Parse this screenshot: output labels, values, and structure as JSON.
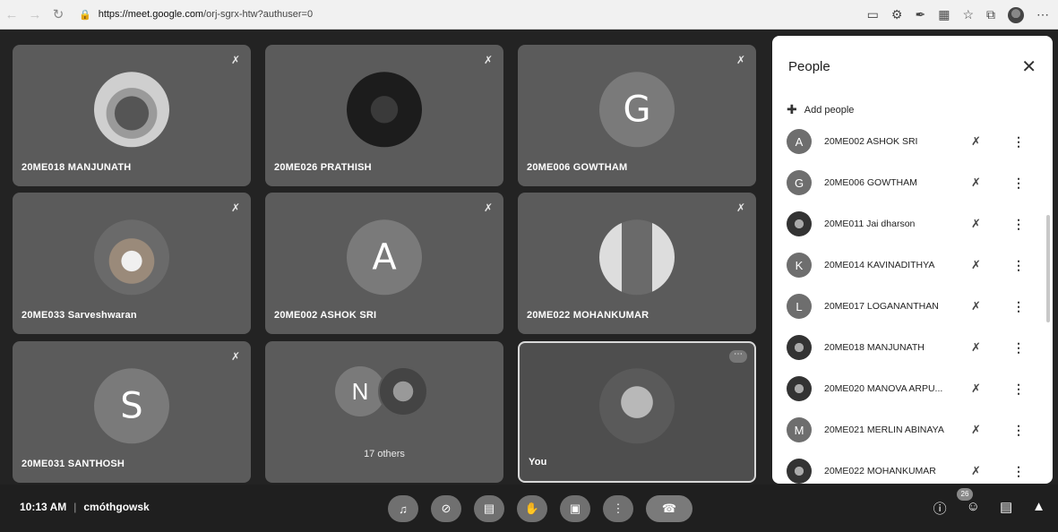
{
  "browser": {
    "url_host": "https://meet.google.com",
    "url_path": "/orj-sgrx-htw?authuser=0",
    "lock_icon": "lock-icon"
  },
  "tiles": [
    {
      "name": "20ME018 MANJUNATH",
      "avatar": "photo"
    },
    {
      "name": "20ME026 PRATHISH",
      "avatar": "photo"
    },
    {
      "name": "20ME006 GOWTHAM",
      "letter": "G"
    },
    {
      "name": "20ME033 Sarveshwaran",
      "avatar": "photo"
    },
    {
      "name": "20ME002 ASHOK SRI",
      "letter": "A"
    },
    {
      "name": "20ME022 MOHANKUMAR",
      "avatar": "photo"
    },
    {
      "name": "20ME031 SANTHOSH",
      "letter": "S"
    },
    {
      "name": "",
      "letter": "N",
      "others_label": "17 others"
    },
    {
      "name": "You",
      "avatar": "photo"
    }
  ],
  "people_panel": {
    "title": "People",
    "close_icon": "close-icon",
    "add_people": "Add people",
    "participants": [
      {
        "initial": "A",
        "name": "20ME002 ASHOK SRI"
      },
      {
        "initial": "G",
        "name": "20ME006 GOWTHAM"
      },
      {
        "initial": "",
        "name": "20ME011 Jai dharson"
      },
      {
        "initial": "K",
        "name": "20ME014 KAVINADITHYA"
      },
      {
        "initial": "L",
        "name": "20ME017 LOGANANTHAN"
      },
      {
        "initial": "",
        "name": "20ME018 MANJUNATH"
      },
      {
        "initial": "",
        "name": "20ME020 MANOVA ARPU..."
      },
      {
        "initial": "M",
        "name": "20ME021 MERLIN ABINAYA"
      },
      {
        "initial": "",
        "name": "20ME022 MOHANKUMAR"
      }
    ]
  },
  "bottom_bar": {
    "time": "10:13 AM",
    "meeting_code": "cmóthgowsk",
    "participant_count": "26"
  }
}
